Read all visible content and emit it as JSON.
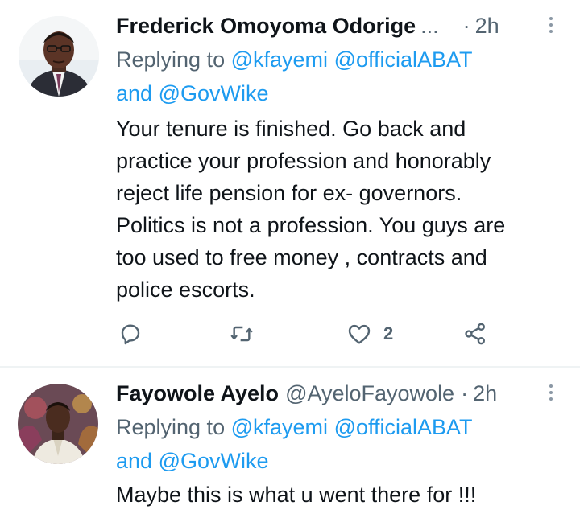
{
  "tweets": [
    {
      "author_name": "Frederick Omoyoma Odorige",
      "author_name_truncation": "...",
      "timestamp": "2h",
      "separator": "·",
      "replying_prefix": "Replying to",
      "replying_mentions_line1": [
        "@kfayemi",
        "@officialABAT"
      ],
      "replying_conjunction": "and",
      "replying_mention_last": "@GovWike",
      "text": "Your tenure is finished. Go back and\npractice your profession and honorably\nreject life pension for ex- governors.\nPolitics is not a profession. You guys are\ntoo used to free money , contracts and\npolice escorts.",
      "actions": {
        "reply_icon": "comment-icon",
        "retweet_icon": "retweet-icon",
        "like_icon": "heart-icon",
        "like_count": "2",
        "share_icon": "share-icon"
      }
    },
    {
      "author_name": "Fayowole Ayelo",
      "author_handle": "@AyeloFayowole",
      "timestamp": "2h",
      "separator": "·",
      "replying_prefix": "Replying to",
      "replying_mentions_line1": [
        "@kfayemi",
        "@officialABAT"
      ],
      "replying_conjunction": "and",
      "replying_mention_last": "@GovWike",
      "text": "Maybe this is what u went there for !!!"
    }
  ],
  "colors": {
    "mention": "#1d9bf0",
    "secondary_text": "#536471",
    "primary_text": "#0f1419",
    "divider": "#eff3f4"
  }
}
